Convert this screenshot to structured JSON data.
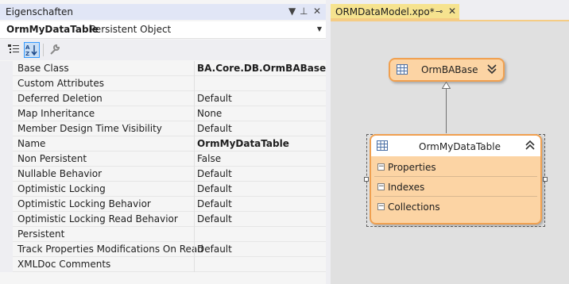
{
  "properties_panel": {
    "title": "Eigenschaften",
    "controls": {
      "dropdown": "▼",
      "pin": "⊥",
      "close": "✕"
    },
    "selected_object": {
      "name": "OrmMyDataTable",
      "type": "Persistent Object"
    },
    "rows": [
      {
        "name": "Base Class",
        "value": "BA.Core.DB.OrmBABase",
        "bold": true
      },
      {
        "name": "Custom Attributes",
        "value": ""
      },
      {
        "name": "Deferred Deletion",
        "value": "Default"
      },
      {
        "name": "Map Inheritance",
        "value": "None"
      },
      {
        "name": "Member Design Time Visibility",
        "value": "Default"
      },
      {
        "name": "Name",
        "value": "OrmMyDataTable",
        "bold": true
      },
      {
        "name": "Non Persistent",
        "value": "False"
      },
      {
        "name": "Nullable Behavior",
        "value": "Default"
      },
      {
        "name": "Optimistic Locking",
        "value": "Default"
      },
      {
        "name": "Optimistic Locking Behavior",
        "value": "Default"
      },
      {
        "name": "Optimistic Locking Read Behavior",
        "value": "Default"
      },
      {
        "name": "Persistent",
        "value": ""
      },
      {
        "name": "Track Properties Modifications On Read",
        "value": "Default"
      },
      {
        "name": "XMLDoc Comments",
        "value": ""
      }
    ]
  },
  "designer": {
    "tab": {
      "label": "ORMDataModel.xpo*",
      "pin": "⊸",
      "close": "✕"
    },
    "base_entity": {
      "name": "OrmBABase",
      "expand_glyph": "⌄⌄"
    },
    "entity": {
      "name": "OrmMyDataTable",
      "collapse_glyph": "⌃⌃",
      "sections": [
        "Properties",
        "Indexes",
        "Collections"
      ],
      "section_toggle": "−"
    }
  },
  "colors": {
    "entity_fill": "#fcd4a4",
    "entity_border": "#f0a050",
    "tab_active": "#f6e38f",
    "panel_title": "#e1e6f6"
  }
}
